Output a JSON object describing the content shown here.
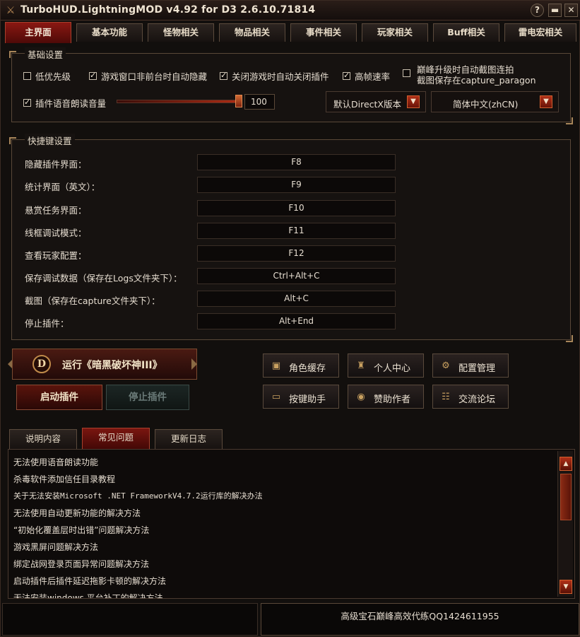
{
  "window": {
    "title": "TurboHUD.LightningMOD v4.92  for D3 2.6.10.71814",
    "help_glyph": "?",
    "minimize_glyph": "▬",
    "close_glyph": "✕"
  },
  "main_tabs": [
    {
      "label": "主界面",
      "active": true
    },
    {
      "label": "基本功能",
      "active": false
    },
    {
      "label": "怪物相关",
      "active": false
    },
    {
      "label": "物品相关",
      "active": false
    },
    {
      "label": "事件相关",
      "active": false
    },
    {
      "label": "玩家相关",
      "active": false
    },
    {
      "label": "Buff相关",
      "active": false
    },
    {
      "label": "雷电宏相关",
      "active": false
    }
  ],
  "basic_settings": {
    "title": "基础设置",
    "low_priority": {
      "label": "低优先级",
      "checked": false
    },
    "auto_hide": {
      "label": "游戏窗口非前台时自动隐藏",
      "checked": true
    },
    "auto_close": {
      "label": "关闭游戏时自动关闭插件",
      "checked": true
    },
    "high_fps": {
      "label": "高帧速率",
      "checked": true
    },
    "paragon_capture": {
      "line1": "巅峰升级时自动截图连拍",
      "line2": "截图保存在capture_paragon",
      "checked": false
    },
    "voice": {
      "label": "插件语音朗读音量",
      "checked": true,
      "volume": "100",
      "level": 1.0
    },
    "directx_select": "默认DirectX版本",
    "language_select": "简体中文(zhCN)"
  },
  "hotkeys": {
    "title": "快捷键设置",
    "items": [
      {
        "label": "隐藏插件界面：",
        "key": "F8"
      },
      {
        "label": "统计界面（英文）：",
        "key": "F9"
      },
      {
        "label": "悬赏任务界面：",
        "key": "F10"
      },
      {
        "label": "线框调试模式：",
        "key": "F11"
      },
      {
        "label": "查看玩家配置：",
        "key": "F12"
      },
      {
        "label": "保存调试数据（保存在Logs文件夹下）：",
        "key": "Ctrl+Alt+C"
      },
      {
        "label": "截图（保存在capture文件夹下）：",
        "key": "Alt+C"
      },
      {
        "label": "停止插件：",
        "key": "Alt+End"
      }
    ]
  },
  "actions": {
    "run_game": "运行《暗黑破坏神III》",
    "run_icon_letter": "D",
    "start_plugin": "启动插件",
    "stop_plugin": "停止插件",
    "tools": [
      {
        "label": "角色缓存",
        "icon": "treasure-chest-icon",
        "glyph": "▣"
      },
      {
        "label": "个人中心",
        "icon": "pedestal-icon",
        "glyph": "♜"
      },
      {
        "label": "配置管理",
        "icon": "gear-tree-icon",
        "glyph": "⚙"
      },
      {
        "label": "按键助手",
        "icon": "monitor-icon",
        "glyph": "▭"
      },
      {
        "label": "赞助作者",
        "icon": "money-bag-icon",
        "glyph": "◉"
      },
      {
        "label": "交流论坛",
        "icon": "users-icon",
        "glyph": "☷"
      }
    ]
  },
  "sub_tabs": [
    {
      "label": "说明内容",
      "active": false
    },
    {
      "label": "常见问题",
      "active": true
    },
    {
      "label": "更新日志",
      "active": false
    }
  ],
  "faq": [
    "无法使用语音朗读功能",
    "杀毒软件添加信任目录教程",
    "关于无法安装Microsoft .NET FrameworkV4.7.2运行库的解决办法",
    "无法使用自动更新功能的解决方法",
    "“初始化覆盖层时出错”问题解决方法",
    "游戏黑屏问题解决方法",
    "绑定战网登录页面异常问题解决方法",
    "启动插件后插件延迟拖影卡顿的解决方法",
    "无法安装windows 平台补丁的解决方法"
  ],
  "status_bar": {
    "ad_text": "高级宝石巅峰高效代练QQ1424611955"
  },
  "colors": {
    "accent_red": "#8a1812",
    "frame_gold": "#a8865a",
    "background": "#120f0d"
  }
}
